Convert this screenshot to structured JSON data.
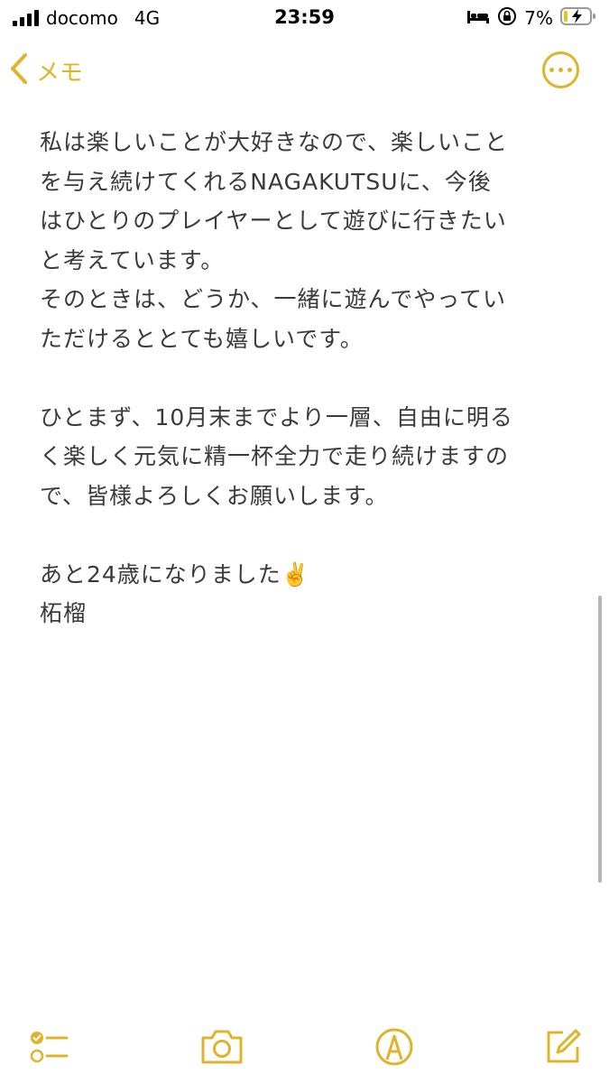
{
  "status_bar": {
    "carrier": "docomo",
    "network": "4G",
    "time": "23:59",
    "battery": "7%"
  },
  "nav": {
    "back_label": "メモ"
  },
  "note": {
    "lines": [
      "私は楽しいことが大好きなので、楽しいこと",
      "を与え続けてくれるNAGAKUTSUに、今後",
      "はひとりのプレイヤーとして遊びに行きたい",
      "と考えています。",
      "そのときは、どうか、一緒に遊んでやってい",
      "ただけるととても嬉しいです。",
      "",
      "ひとまず、10月末までより一層、自由に明る",
      "く楽しく元気に精一杯全力で走り続けますの",
      "で、皆様よろしくお願いします。",
      "",
      "あと24歳になりました✌️",
      "柘榴"
    ]
  },
  "colors": {
    "accent": "#e0b42a",
    "text": "#3a3a3c"
  },
  "icons": {
    "toolbar": [
      "checklist-icon",
      "camera-icon",
      "markup-icon",
      "compose-icon"
    ]
  }
}
